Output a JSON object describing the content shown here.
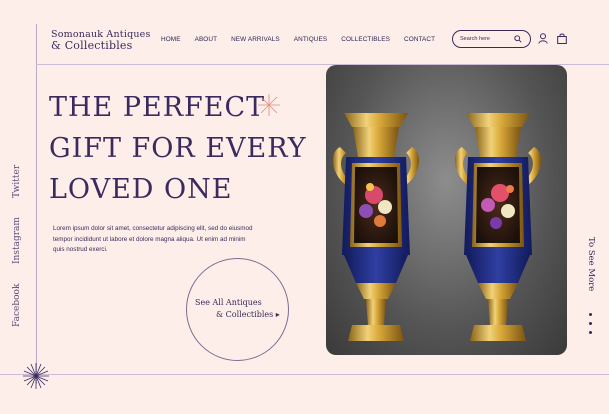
{
  "logo": {
    "line1": "Somonauk Antiques",
    "line2": "& Collectibles"
  },
  "nav": [
    "HOME",
    "ABOUT",
    "NEW ARRIVALS",
    "ANTIQUES",
    "COLLECTIBLES",
    "CONTACT"
  ],
  "search": {
    "placeholder": "Search here",
    "icon": "search-icon"
  },
  "icons": {
    "user": "user-icon",
    "bag": "shopping-bag-icon",
    "spark": "sparkle-icon"
  },
  "hero": {
    "headline_line1": "THE PERFECT",
    "headline_line2": "GIFT FOR EVERY",
    "headline_line3": "LOVED ONE",
    "body": "Lorem ipsum dolor sit amet, consectetur adipiscing elit, sed do eiusmod tempor incididunt ut labore et dolore magna aliqua. Ut enim ad minim quis nostrud exerci.",
    "cta_line1": "See All Antiques",
    "cta_line2": "& Collectibles ▸"
  },
  "social": [
    "Facebook",
    "Instagram",
    "Twitter"
  ],
  "see_more": "To See More",
  "colors": {
    "background": "#fdeee9",
    "ink": "#3a2a5c",
    "accent": "#e08a7a"
  }
}
